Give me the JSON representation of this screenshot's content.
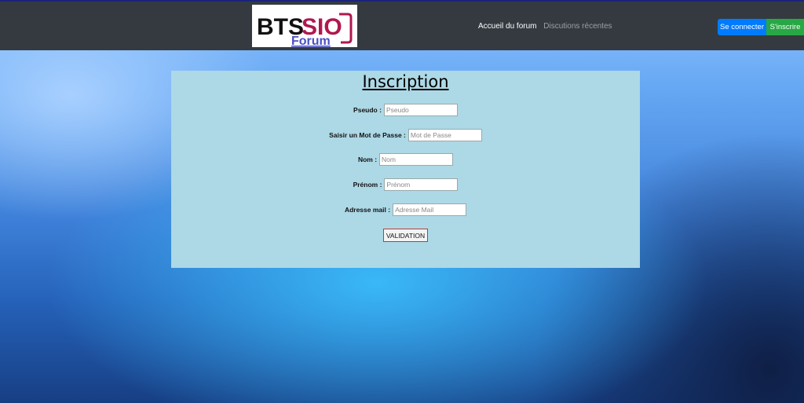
{
  "navbar": {
    "logo": {
      "text_main": "BTSSIO",
      "text_sub": "Forum"
    },
    "links": [
      {
        "label": "Accueil du forum",
        "active": true
      },
      {
        "label": "Discutions récentes",
        "active": false
      }
    ],
    "login_label": "Se connecter",
    "signup_label": "S'inscrire"
  },
  "form": {
    "title": "Inscription",
    "fields": [
      {
        "label": "Pseudo :",
        "placeholder": "Pseudo"
      },
      {
        "label": "Saisir un Mot de Passe :",
        "placeholder": "Mot de Passe"
      },
      {
        "label": "Nom :",
        "placeholder": "Nom"
      },
      {
        "label": "Prénom :",
        "placeholder": "Prénom"
      },
      {
        "label": "Adresse mail :",
        "placeholder": "Adresse Mail"
      }
    ],
    "submit_label": "VALIDATION"
  },
  "colors": {
    "navbar": "#343a40",
    "login_button": "#007bff",
    "signup_button": "#28a745",
    "card": "#add8e6",
    "logo_accent": "#b0174f",
    "logo_sub": "#4a4fc4"
  }
}
